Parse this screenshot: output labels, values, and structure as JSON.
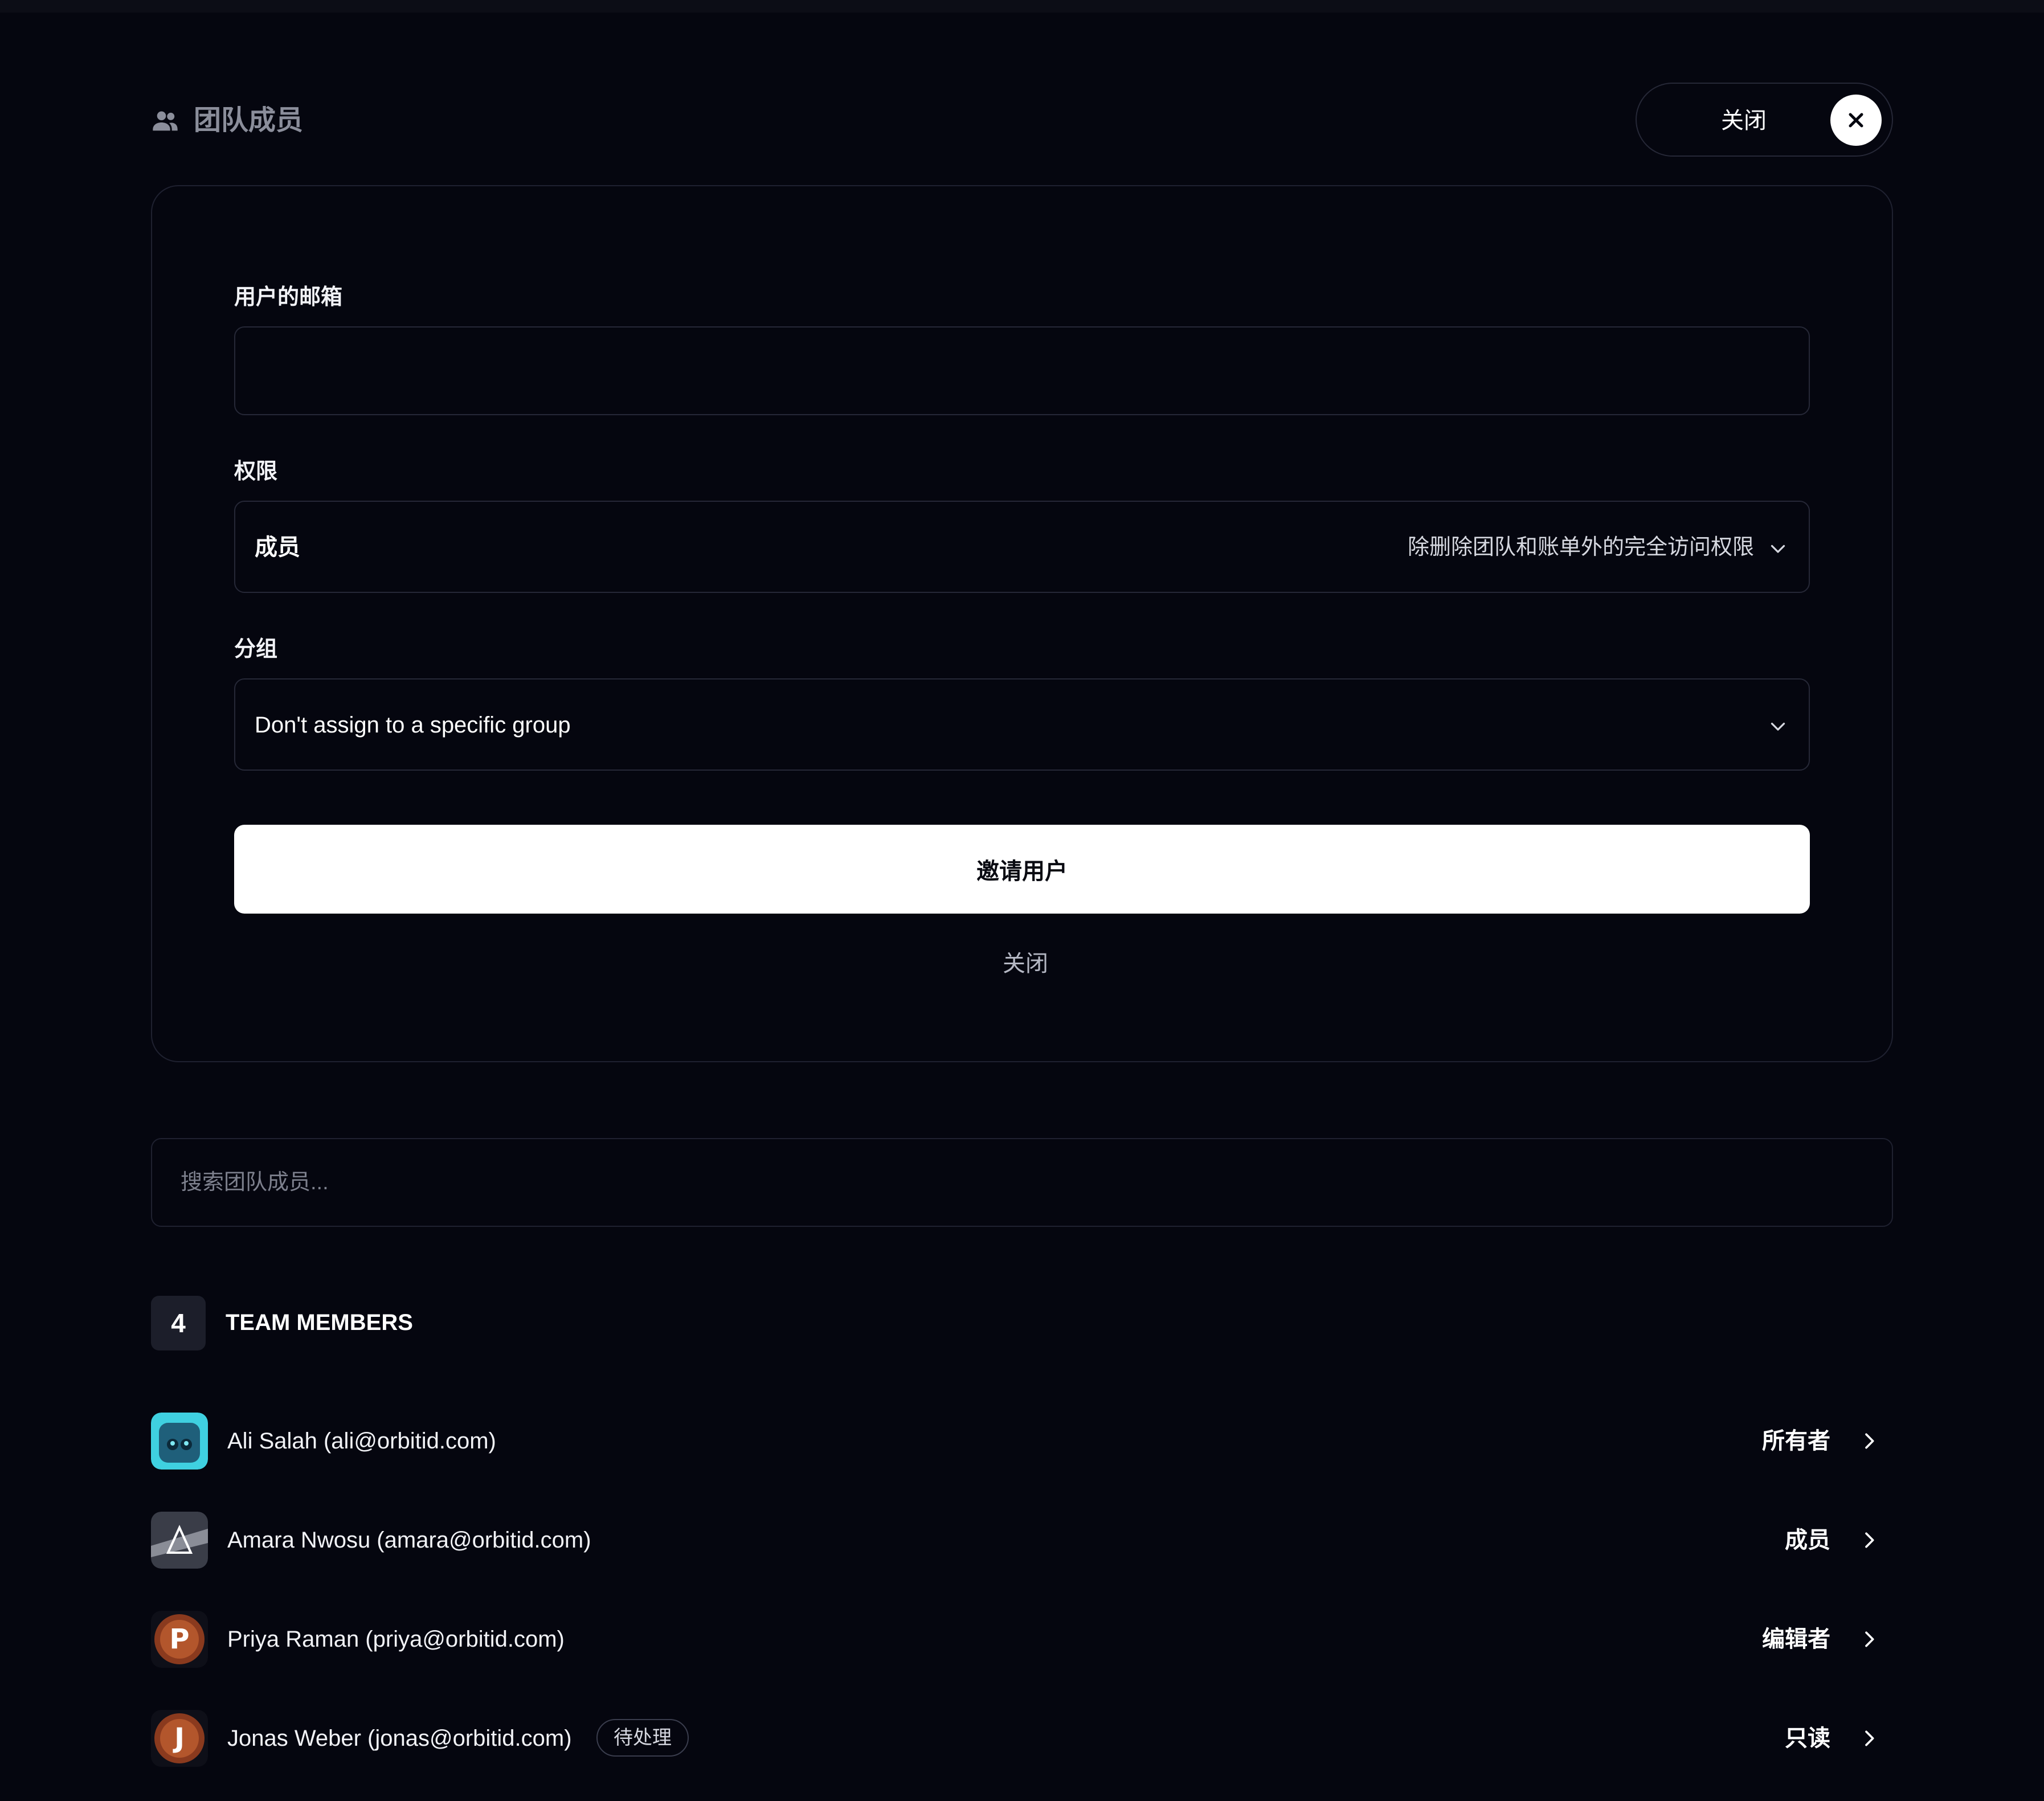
{
  "header": {
    "title": "团队成员",
    "icon": "users-icon",
    "close_label": "关闭"
  },
  "invite_form": {
    "email_label": "用户的邮箱",
    "email_value": "",
    "email_placeholder": "",
    "permission_label": "权限",
    "permission_value": "成员",
    "permission_description": "除删除团队和账单外的完全访问权限",
    "group_label": "分组",
    "group_value": "Don't assign to a specific group",
    "invite_button": "邀请用户",
    "cancel_link": "关闭"
  },
  "search": {
    "placeholder": "搜索团队成员...",
    "value": ""
  },
  "members_section": {
    "count": "4",
    "title": "TEAM MEMBERS"
  },
  "members": [
    {
      "name": "Ali Salah (ali@orbitid.com)",
      "role": "所有者",
      "badge": ""
    },
    {
      "name": "Amara Nwosu (amara@orbitid.com)",
      "role": "成员",
      "badge": ""
    },
    {
      "name": "Priya Raman (priya@orbitid.com)",
      "role": "编辑者",
      "badge": ""
    },
    {
      "name": "Jonas Weber (jonas@orbitid.com)",
      "role": "只读",
      "badge": "待处理"
    }
  ],
  "colors": {
    "background": "#05060f",
    "border": "#262837",
    "primary_button": "#ffffff",
    "muted_text": "#8b8e9b"
  }
}
